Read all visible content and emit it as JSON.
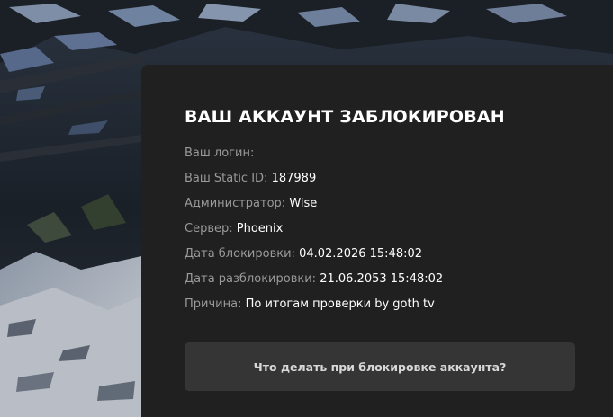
{
  "panel": {
    "title": "ВАШ АККАУНТ ЗАБЛОКИРОВАН",
    "fields": {
      "login": {
        "label": "Ваш логин:",
        "value": ""
      },
      "static_id": {
        "label": "Ваш Static ID:",
        "value": "187989"
      },
      "admin": {
        "label": "Администратор:",
        "value": "Wise"
      },
      "server": {
        "label": "Сервер:",
        "value": "Phoenix"
      },
      "block_date": {
        "label": "Дата блокировки:",
        "value": "04.02.2026 15:48:02"
      },
      "unblock_date": {
        "label": "Дата разблокировки:",
        "value": "21.06.2053 15:48:02"
      },
      "reason": {
        "label": "Причина:",
        "value": "По итогам проверки by goth tv"
      }
    },
    "help_button_label": "Что делать при блокировке аккаунта?"
  },
  "colors": {
    "panel_bg": "#202020",
    "button_bg": "#353535",
    "label": "#9a9a9a",
    "value": "#ffffff"
  }
}
